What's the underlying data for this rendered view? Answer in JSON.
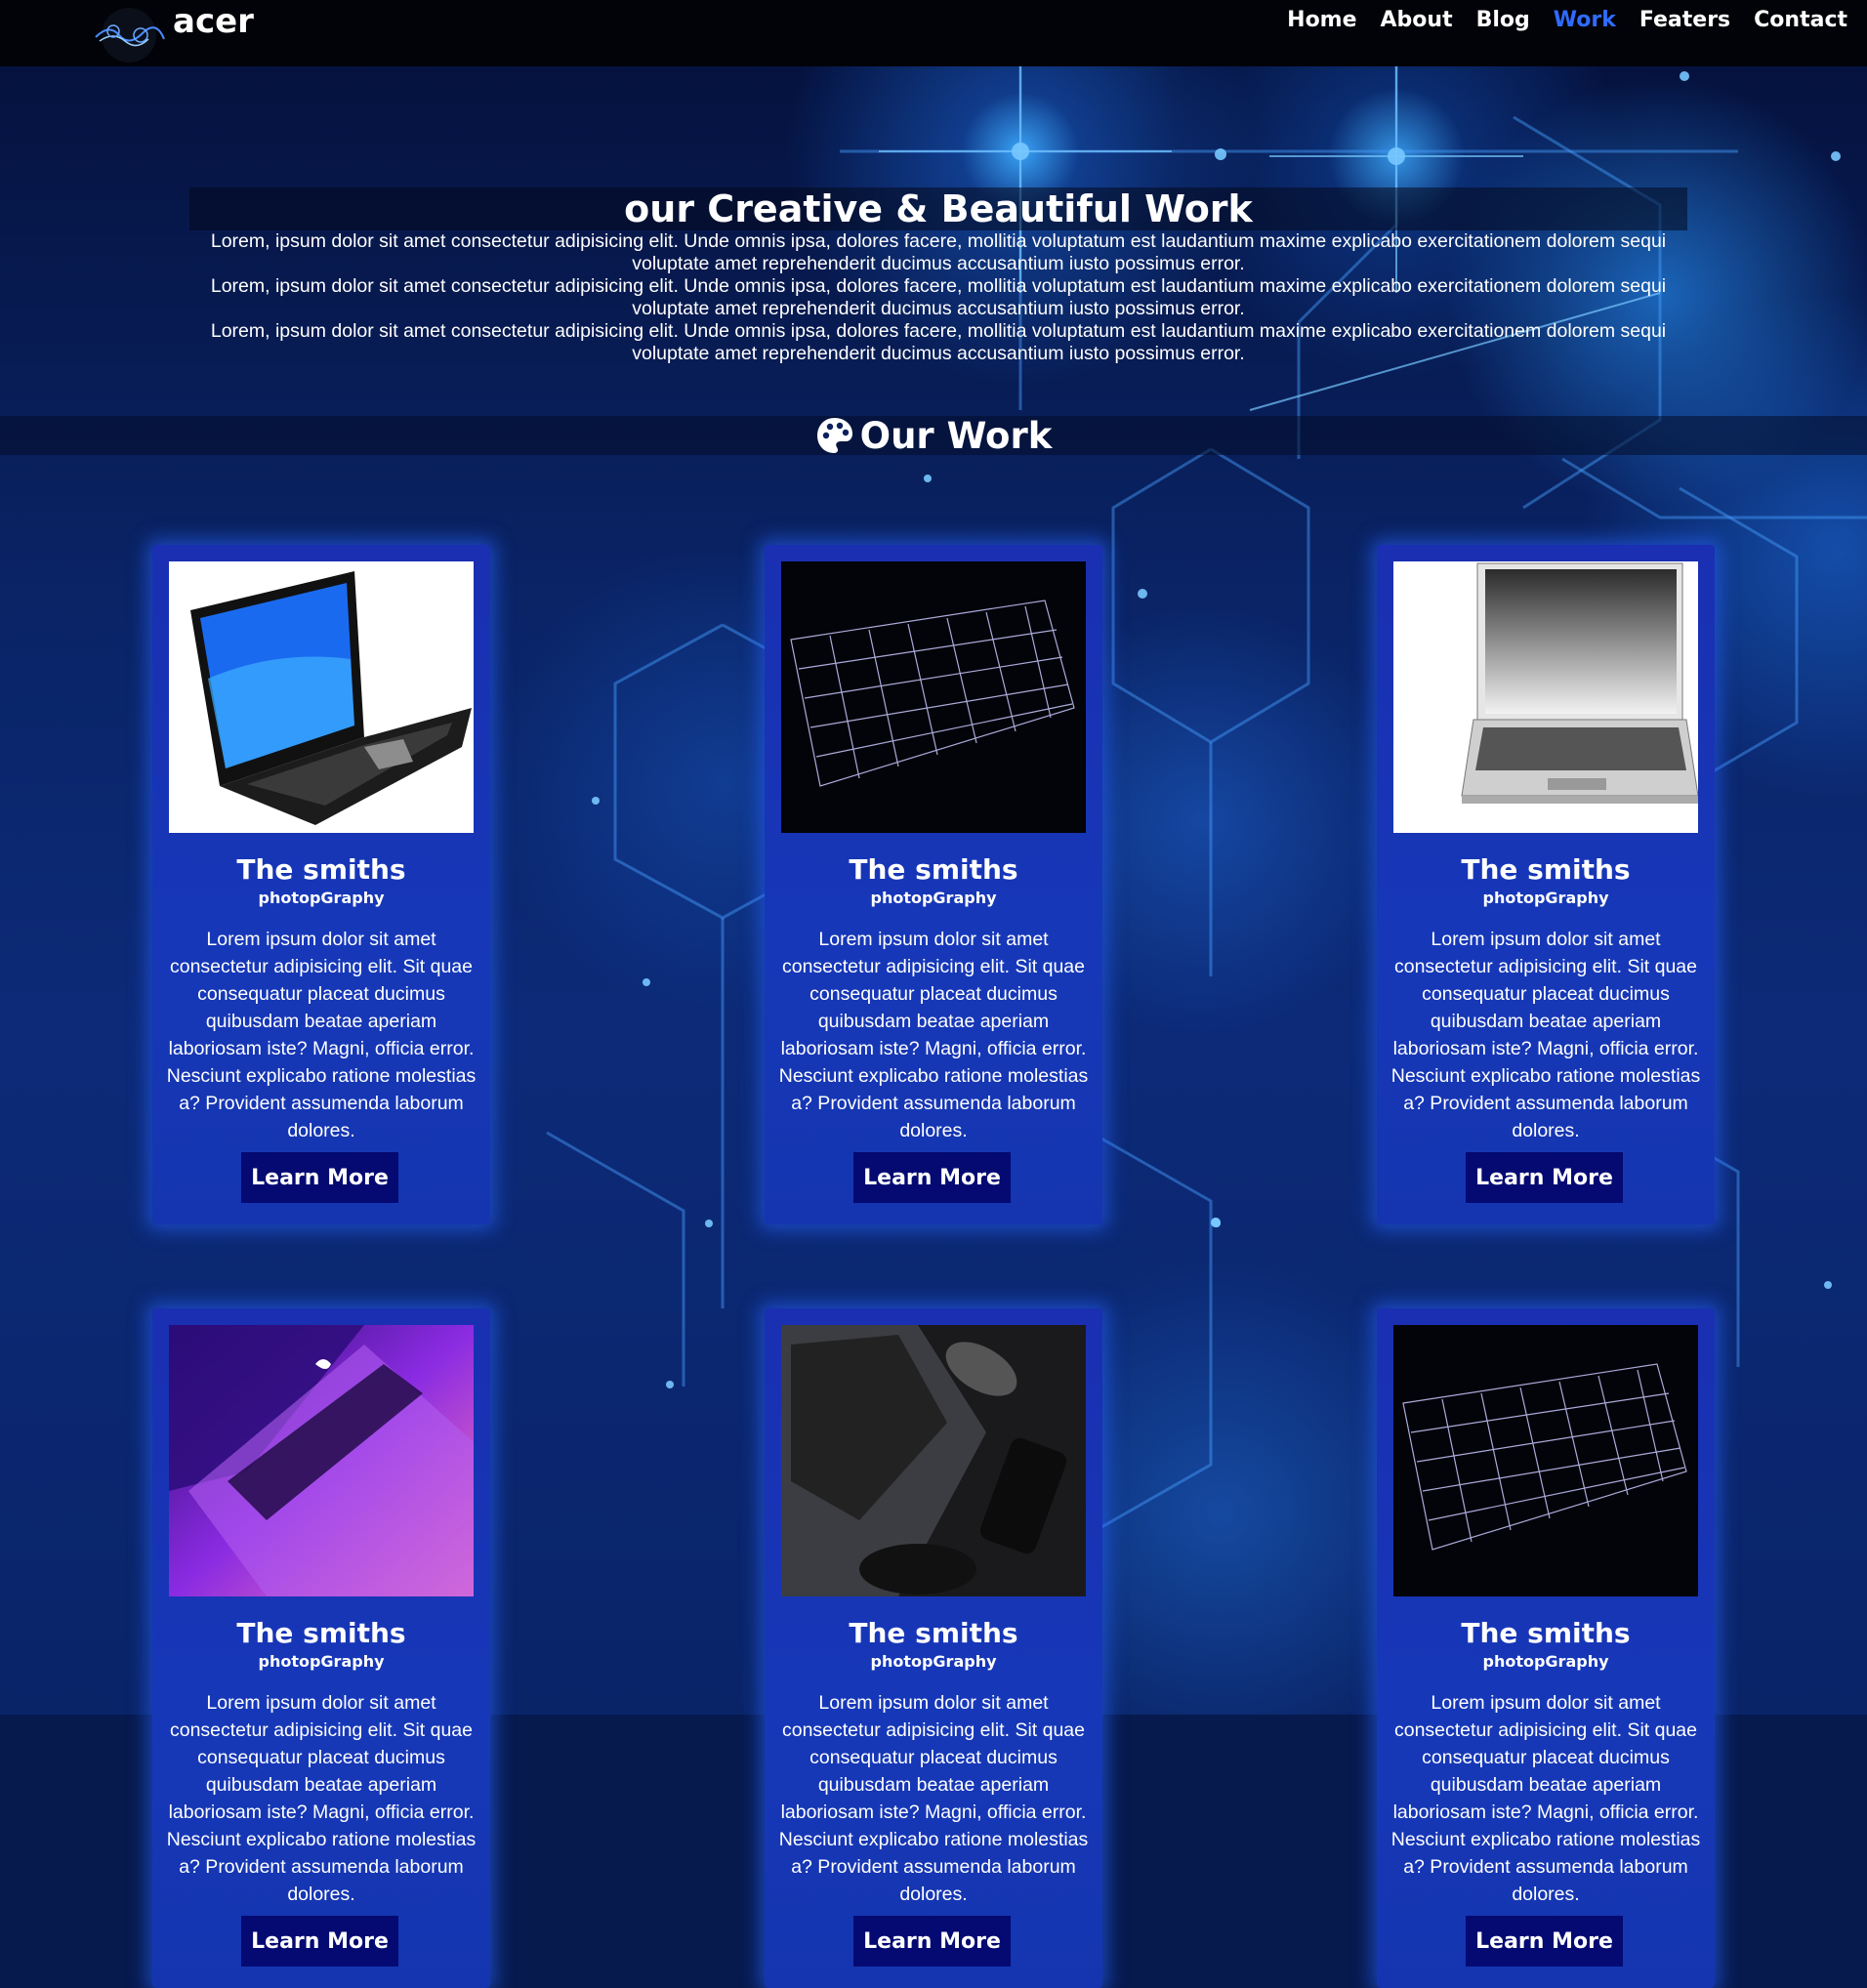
{
  "brand": {
    "name": "acer"
  },
  "nav": {
    "items": [
      {
        "label": "Home"
      },
      {
        "label": "About"
      },
      {
        "label": "Blog"
      },
      {
        "label": "Work",
        "active": true
      },
      {
        "label": "Featers"
      },
      {
        "label": "Contact"
      }
    ],
    "active_color": "#2f6bff"
  },
  "hero": {
    "title": "our Creative & Beautiful Work",
    "paragraphs": [
      "Lorem, ipsum dolor sit amet consectetur adipisicing elit. Unde omnis ipsa, dolores facere, mollitia voluptatum est laudantium maxime explicabo exercitationem dolorem sequi voluptate amet reprehenderit ducimus accusantium iusto possimus error.",
      "Lorem, ipsum dolor sit amet consectetur adipisicing elit. Unde omnis ipsa, dolores facere, mollitia voluptatum est laudantium maxime explicabo exercitationem dolorem sequi voluptate amet reprehenderit ducimus accusantium iusto possimus error.",
      "Lorem, ipsum dolor sit amet consectetur adipisicing elit. Unde omnis ipsa, dolores facere, mollitia voluptatum est laudantium maxime explicabo exercitationem dolorem sequi voluptate amet reprehenderit ducimus accusantium iusto possimus error."
    ]
  },
  "section": {
    "title": "Our Work",
    "icon": "palette-icon"
  },
  "cards": [
    {
      "image": "laptop-blue-screen",
      "title": "The smiths",
      "subtitle": "photopGraphy",
      "text": "Lorem ipsum dolor sit amet consectetur adipisicing elit. Sit quae consequatur placeat ducimus quibusdam beatae aperiam laboriosam iste? Magni, officia error. Nesciunt explicabo ratione molestias a? Provident assumenda laborum dolores.",
      "button": "Learn More"
    },
    {
      "image": "backlit-keyboard",
      "title": "The smiths",
      "subtitle": "photopGraphy",
      "text": "Lorem ipsum dolor sit amet consectetur adipisicing elit. Sit quae consequatur placeat ducimus quibusdam beatae aperiam laboriosam iste? Magni, officia error. Nesciunt explicabo ratione molestias a? Provident assumenda laborum dolores.",
      "button": "Learn More"
    },
    {
      "image": "silver-laptop",
      "title": "The smiths",
      "subtitle": "photopGraphy",
      "text": "Lorem ipsum dolor sit amet consectetur adipisicing elit. Sit quae consequatur placeat ducimus quibusdam beatae aperiam laboriosam iste? Magni, officia error. Nesciunt explicabo ratione molestias a? Provident assumenda laborum dolores.",
      "button": "Learn More"
    },
    {
      "image": "purple-laptop",
      "title": "The smiths",
      "subtitle": "photopGraphy",
      "text": "Lorem ipsum dolor sit amet consectetur adipisicing elit. Sit quae consequatur placeat ducimus quibusdam beatae aperiam laboriosam iste? Magni, officia error. Nesciunt explicabo ratione molestias a? Provident assumenda laborum dolores.",
      "button": "Learn More"
    },
    {
      "image": "dark-desk-setup",
      "title": "The smiths",
      "subtitle": "photopGraphy",
      "text": "Lorem ipsum dolor sit amet consectetur adipisicing elit. Sit quae consequatur placeat ducimus quibusdam beatae aperiam laboriosam iste? Magni, officia error. Nesciunt explicabo ratione molestias a? Provident assumenda laborum dolores.",
      "button": "Learn More"
    },
    {
      "image": "backlit-keyboard",
      "title": "The smiths",
      "subtitle": "photopGraphy",
      "text": "Lorem ipsum dolor sit amet consectetur adipisicing elit. Sit quae consequatur placeat ducimus quibusdam beatae aperiam laboriosam iste? Magni, officia error. Nesciunt explicabo ratione molestias a? Provident assumenda laborum dolores.",
      "button": "Learn More"
    }
  ],
  "colors": {
    "navbar": "#020308",
    "card": "#1a2fb2",
    "button": "#040a72",
    "glow": "#2864ff"
  }
}
